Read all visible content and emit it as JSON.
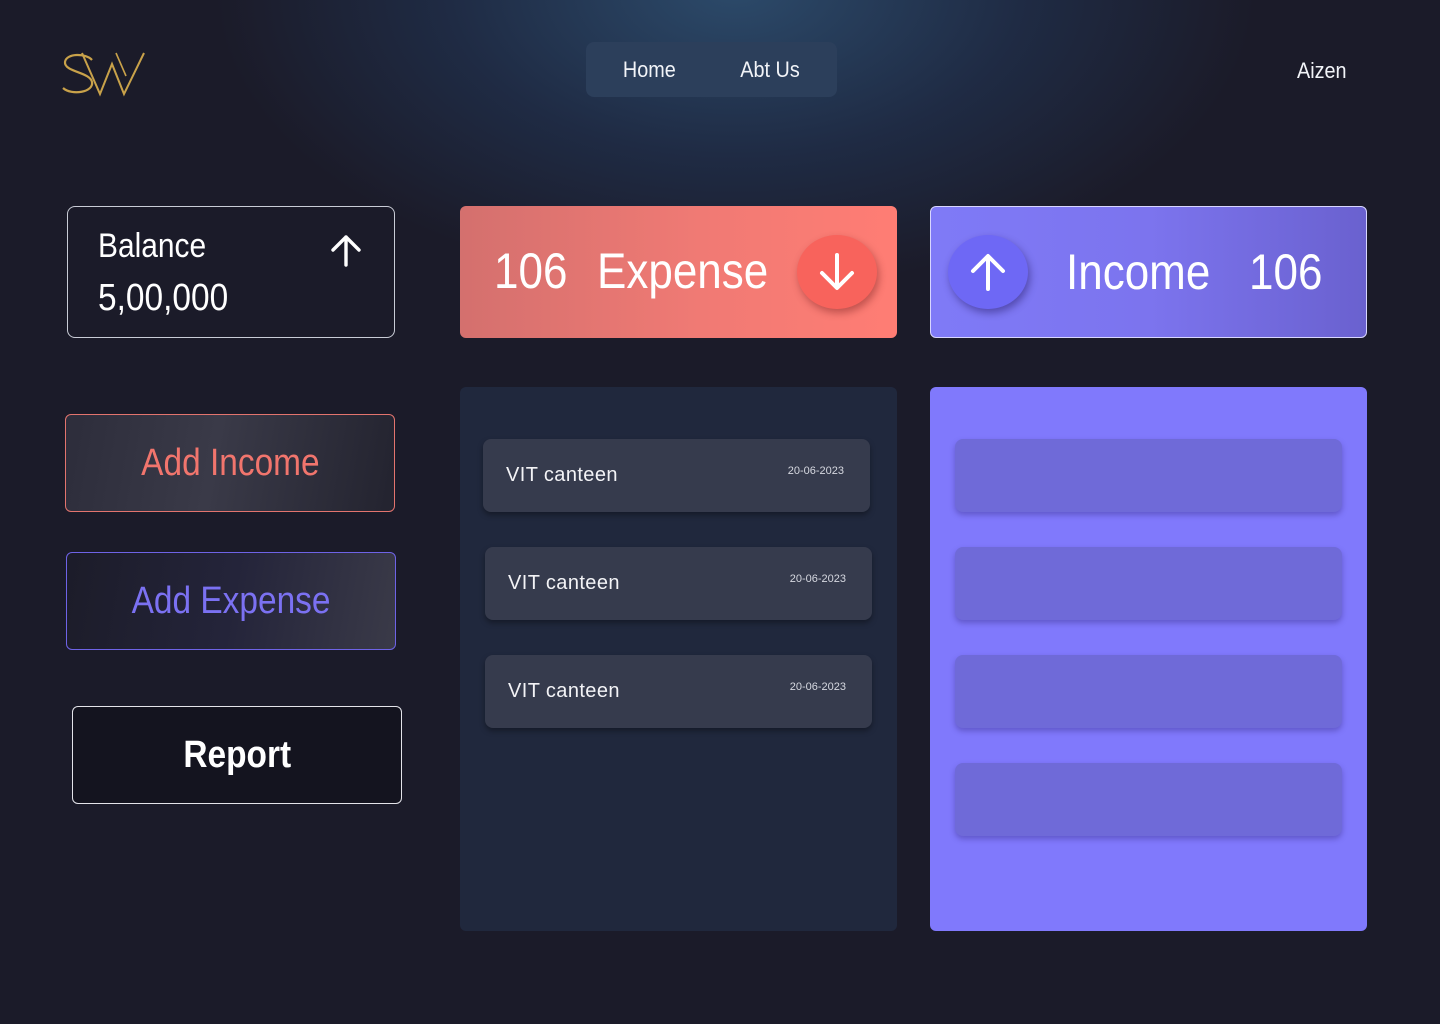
{
  "header": {
    "logo_text": "SW",
    "nav": {
      "home": "Home",
      "about": "Abt Us"
    },
    "user": "Aizen"
  },
  "balance": {
    "title": "Balance",
    "value": "5,00,000",
    "icon": "arrow-up-icon"
  },
  "expense_banner": {
    "count": "106",
    "label": "Expense",
    "icon": "arrow-down-icon"
  },
  "income_banner": {
    "count": "106",
    "label": "Income",
    "icon": "arrow-up-icon"
  },
  "actions": {
    "add_income": "Add Income",
    "add_expense": "Add Expense",
    "report": "Report"
  },
  "expense_list": [
    {
      "name": "VIT canteen",
      "date": "20-06-2023"
    },
    {
      "name": "VIT canteen",
      "date": "20-06-2023"
    },
    {
      "name": "VIT canteen",
      "date": "20-06-2023"
    }
  ],
  "colors": {
    "background": "#1b1b29",
    "expense_accent": "#f07a74",
    "income_accent": "#8079fc",
    "logo_gold": "#c9a24a"
  }
}
